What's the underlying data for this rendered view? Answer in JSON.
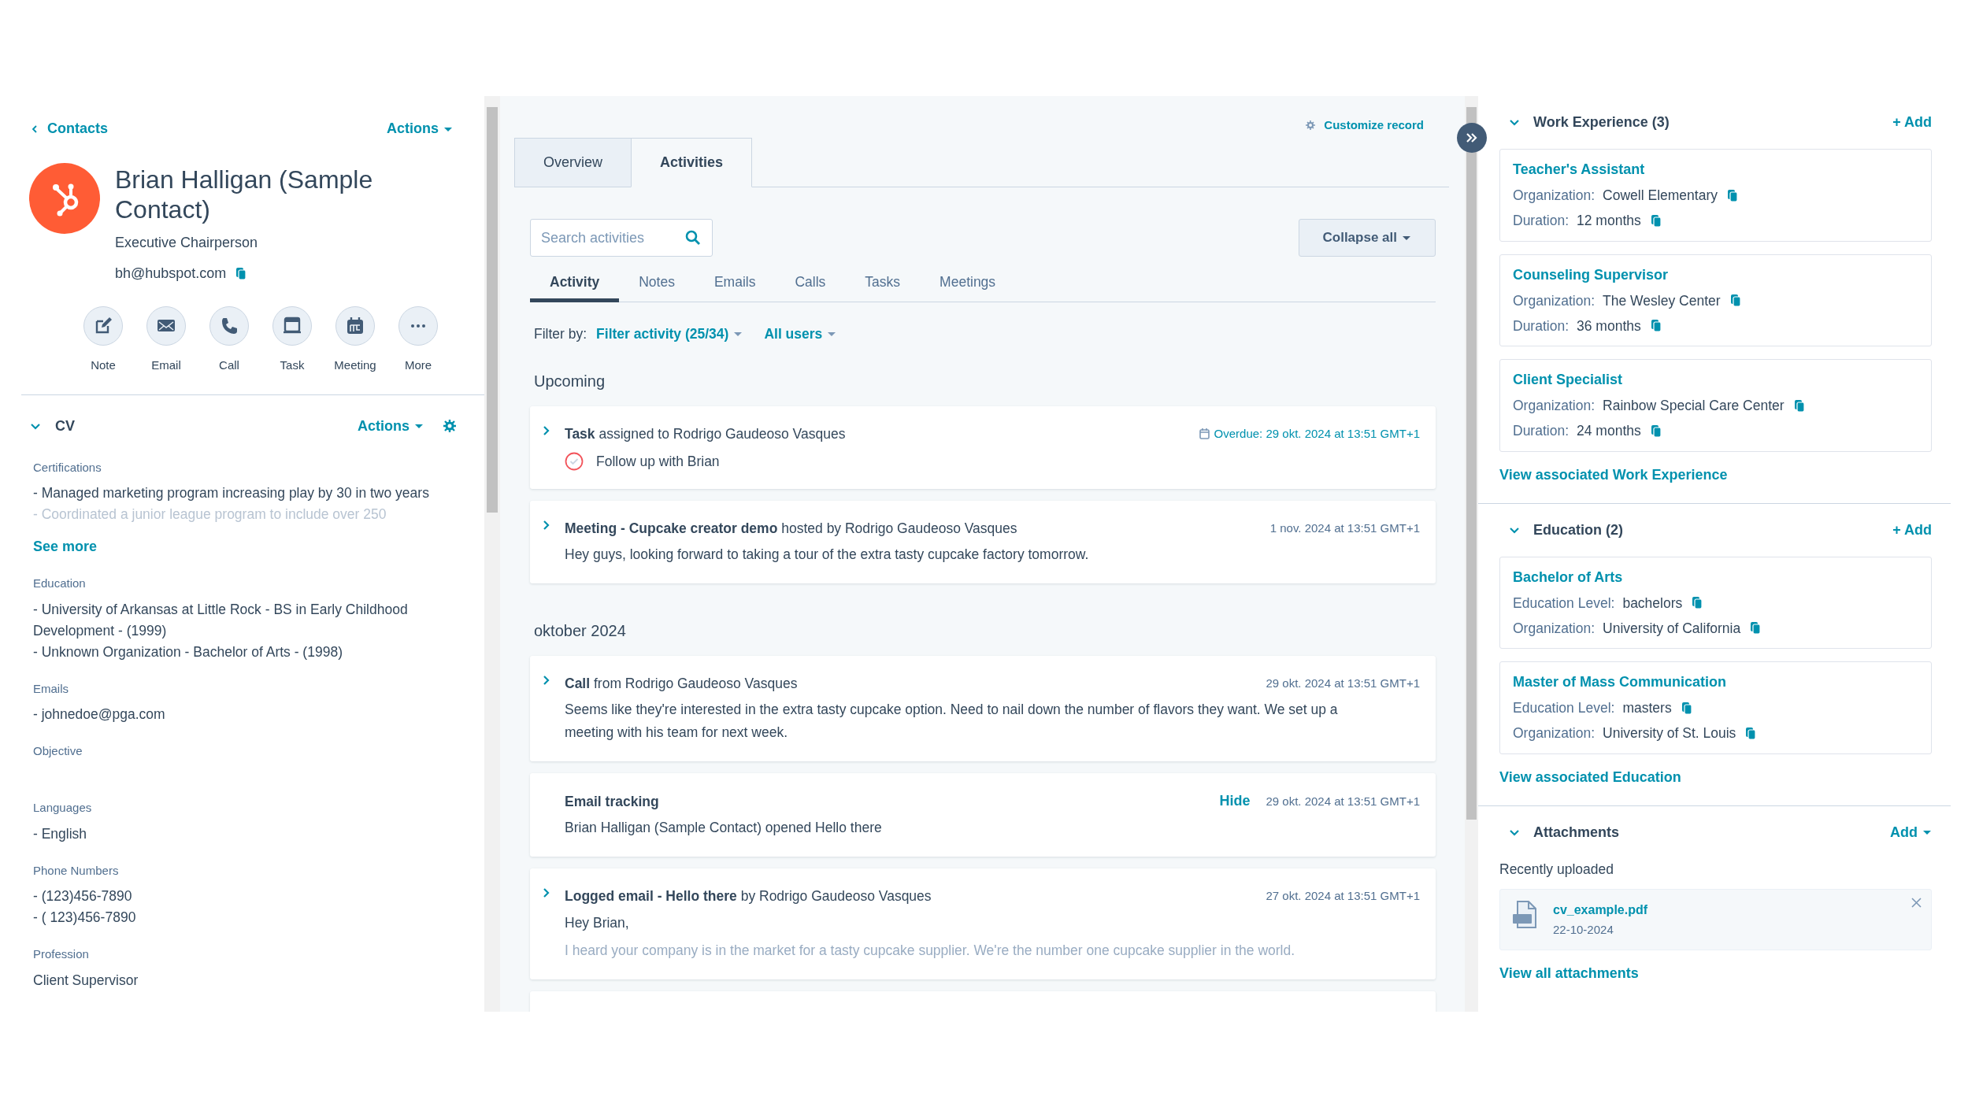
{
  "left_panel": {
    "back_link": "Contacts",
    "actions": "Actions",
    "contact": {
      "name": "Brian Halligan (Sample Contact)",
      "title": "Executive Chairperson",
      "email": "bh@hubspot.com"
    },
    "quick_actions": [
      {
        "label": "Note",
        "kind": "note"
      },
      {
        "label": "Email",
        "kind": "email"
      },
      {
        "label": "Call",
        "kind": "call"
      },
      {
        "label": "Task",
        "kind": "task"
      },
      {
        "label": "Meeting",
        "kind": "meeting"
      },
      {
        "label": "More",
        "kind": "more"
      }
    ],
    "cv": {
      "title": "CV",
      "expanded": true,
      "actions": "Actions",
      "fields": [
        {
          "label": "Certifications",
          "lines": [
            "- Managed marketing program increasing play by 30 in two years"
          ],
          "faded_line": "- Coordinated a junior league program to include over 250",
          "see_more": "See more"
        },
        {
          "label": "Education",
          "lines": [
            "- University of Arkansas at Little Rock - BS in Early Childhood Development - (1999)",
            "- Unknown Organization - Bachelor of Arts - (1998)"
          ]
        },
        {
          "label": "Emails",
          "lines": [
            "- johnedoe@pga.com"
          ]
        },
        {
          "label": "Objective"
        },
        {
          "label": "Languages",
          "lines": [
            "- English"
          ]
        },
        {
          "label": "Phone Numbers",
          "lines": [
            "- (123)456-7890",
            "- ( 123)456-7890"
          ]
        },
        {
          "label": "Profession",
          "lines": [
            "Client Supervisor"
          ]
        }
      ]
    }
  },
  "main_panel": {
    "customize": "Customize record",
    "tabs": [
      {
        "label": "Overview",
        "selected": false
      },
      {
        "label": "Activities",
        "selected": true
      }
    ],
    "search": {
      "placeholder": "Search activities"
    },
    "collapse_all": "Collapse all",
    "activity_tabs": [
      {
        "label": "Activity",
        "selected": true
      },
      {
        "label": "Notes",
        "selected": false
      },
      {
        "label": "Emails",
        "selected": false
      },
      {
        "label": "Calls",
        "selected": false
      },
      {
        "label": "Tasks",
        "selected": false
      },
      {
        "label": "Meetings",
        "selected": false
      }
    ],
    "filter": {
      "label": "Filter by:",
      "activity": "Filter activity (25/34)",
      "users": "All users"
    },
    "groups": [
      {
        "title": "Upcoming",
        "items": [
          {
            "kind": "task",
            "expandable": true,
            "title": "**Task** assigned to Rodrigo Gaudeoso Vasques",
            "date": "Overdue: 29 okt. 2024 at 13:51 GMT+1",
            "overdue": true,
            "task": "Follow up with Brian",
            "completed": false
          },
          {
            "kind": "meeting",
            "expandable": true,
            "title": "**Meeting - Cupcake creator demo** hosted by Rodrigo Gaudeoso Vasques",
            "date": "1 nov. 2024 at 13:51 GMT+1",
            "overdue": false,
            "body": "Hey guys, looking forward to taking a tour of the extra tasty cupcake factory tomorrow."
          }
        ]
      },
      {
        "title": "oktober 2024",
        "items": [
          {
            "kind": "call",
            "expandable": true,
            "title": "**Call** from Rodrigo Gaudeoso Vasques",
            "date": "29 okt. 2024 at 13:51 GMT+1",
            "overdue": false,
            "body": "Seems like they're interested in the extra tasty cupcake option. Need to nail down the number of flavors they want. We set up a meeting with his team for next week."
          },
          {
            "kind": "tracking",
            "expandable": false,
            "title": "Email tracking",
            "hide": "Hide",
            "date": "29 okt. 2024 at 13:51 GMT+1",
            "overdue": false,
            "body": "Brian Halligan (Sample Contact) opened Hello there"
          },
          {
            "kind": "email",
            "expandable": true,
            "title": "**Logged email - Hello there** by Rodrigo Gaudeoso Vasques",
            "date": "27 okt. 2024 at 13:51 GMT+1",
            "overdue": false,
            "body": "Hey Brian,",
            "preview": "I heard your company is in the market for a tasty cupcake supplier. We're the number one cupcake supplier in the world."
          },
          {
            "kind": "cutoff"
          }
        ]
      }
    ]
  },
  "right_panel": {
    "sections": [
      {
        "kind": "records",
        "title": "Work Experience (3)",
        "expanded": true,
        "add": "+ Add",
        "cards": [
          {
            "title": "Teacher's Assistant",
            "fields": [
              {
                "label": "Organization:",
                "value": "Cowell Elementary"
              },
              {
                "label": "Duration:",
                "value": "12 months"
              }
            ]
          },
          {
            "title": "Counseling Supervisor",
            "fields": [
              {
                "label": "Organization:",
                "value": "The Wesley Center"
              },
              {
                "label": "Duration:",
                "value": "36 months"
              }
            ]
          },
          {
            "title": "Client Specialist",
            "fields": [
              {
                "label": "Organization:",
                "value": "Rainbow Special Care Center"
              },
              {
                "label": "Duration:",
                "value": "24 months"
              }
            ]
          }
        ],
        "view_link": "View associated Work Experience"
      },
      {
        "kind": "records",
        "title": "Education (2)",
        "expanded": true,
        "add": "+ Add",
        "cards": [
          {
            "title": "Bachelor of Arts",
            "fields": [
              {
                "label": "Education Level:",
                "value": "bachelors"
              },
              {
                "label": "Organization:",
                "value": "University of California"
              }
            ]
          },
          {
            "title": "Master of Mass Communication",
            "fields": [
              {
                "label": "Education Level:",
                "value": "masters"
              },
              {
                "label": "Organization:",
                "value": "University of St. Louis"
              }
            ]
          }
        ],
        "view_link": "View associated Education"
      },
      {
        "kind": "attachments",
        "title": "Attachments",
        "expanded": true,
        "add": "Add",
        "subtitle": "Recently uploaded",
        "files": [
          {
            "name": "cv_example.pdf",
            "date": "22-10-2024"
          }
        ],
        "view_link": "View all attachments"
      }
    ]
  }
}
